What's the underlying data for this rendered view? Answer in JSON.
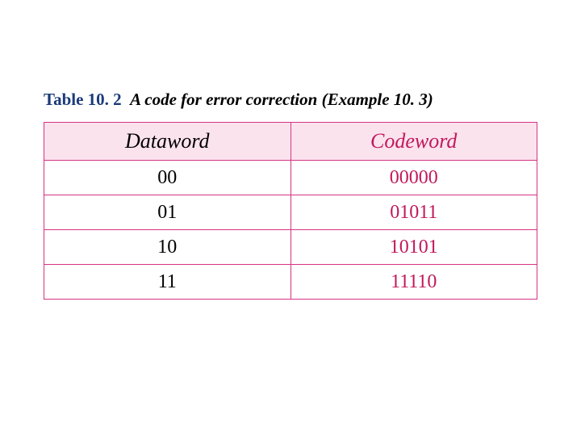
{
  "caption": {
    "label": "Table 10. 2",
    "title": "A code for error correction (Example 10. 3)"
  },
  "table": {
    "headers": {
      "dataword": "Dataword",
      "codeword": "Codeword"
    },
    "rows": [
      {
        "dataword": "00",
        "codeword": "00000"
      },
      {
        "dataword": "01",
        "codeword": "01011"
      },
      {
        "dataword": "10",
        "codeword": "10101"
      },
      {
        "dataword": "11",
        "codeword": "11110"
      }
    ]
  }
}
